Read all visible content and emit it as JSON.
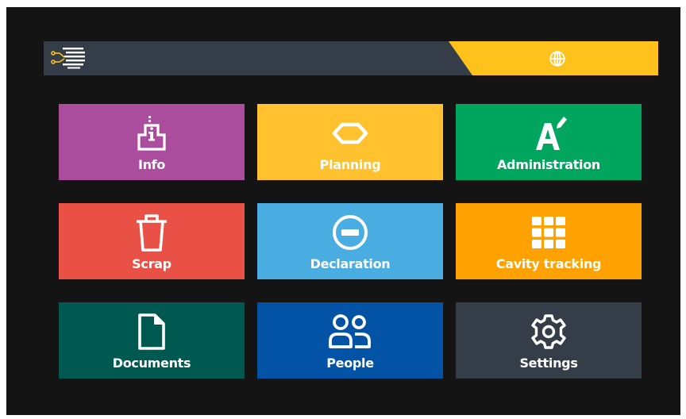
{
  "colors": {
    "background": "#141414",
    "topbar": "#353d48",
    "accent": "#ffc21c"
  },
  "topbar": {
    "logo_icon": "circuit-lines-logo",
    "language_icon": "globe-icon"
  },
  "tiles": [
    {
      "label": "Info",
      "icon": "info-kiosk-icon",
      "color": "#ab4d9d"
    },
    {
      "label": "Planning",
      "icon": "hexagon-icon",
      "color": "#ffc12e"
    },
    {
      "label": "Administration",
      "icon": "letter-a-pencil-icon",
      "color": "#00a65e"
    },
    {
      "label": "Scrap",
      "icon": "trash-icon",
      "color": "#ea5146"
    },
    {
      "label": "Declaration",
      "icon": "minus-circle-icon",
      "color": "#4aade2"
    },
    {
      "label": "Cavity tracking",
      "icon": "grid-icon",
      "color": "#ffa100"
    },
    {
      "label": "Documents",
      "icon": "document-icon",
      "color": "#005950"
    },
    {
      "label": "People",
      "icon": "people-icon",
      "color": "#0252a6"
    },
    {
      "label": "Settings",
      "icon": "gear-icon",
      "color": "#353d48"
    }
  ]
}
